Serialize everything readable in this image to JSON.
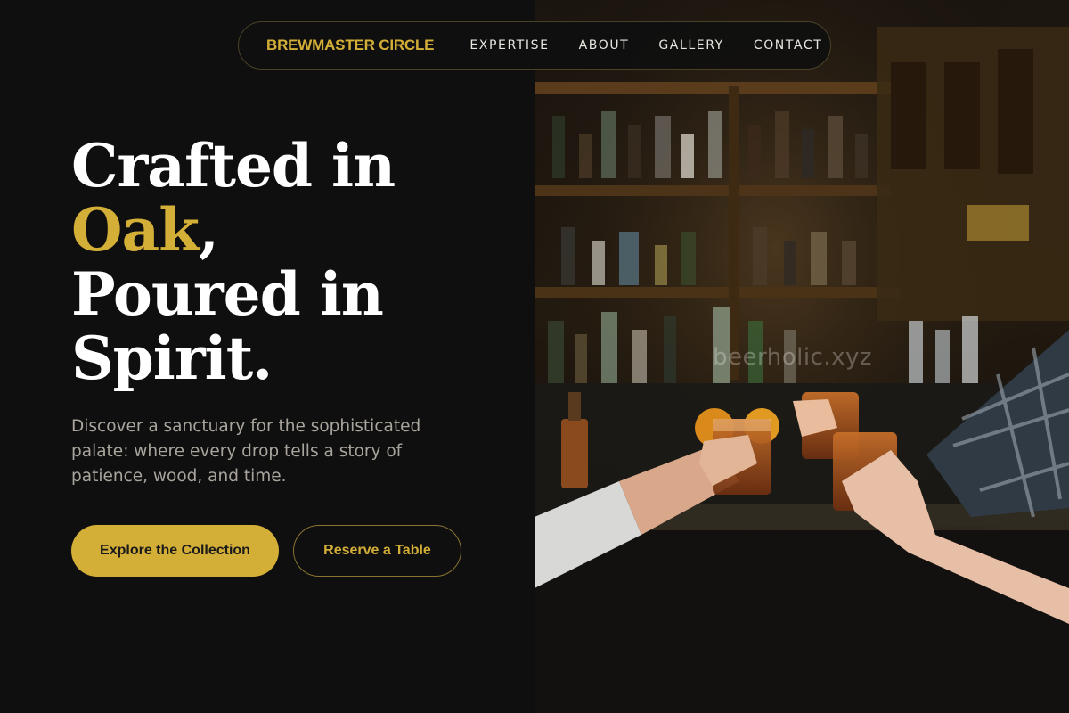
{
  "nav": {
    "brand": "BREWMASTER CIRCLE",
    "links": [
      "EXPERTISE",
      "ABOUT",
      "GALLERY",
      "CONTACT"
    ]
  },
  "hero": {
    "title_line1": "Crafted in",
    "title_accent": "Oak",
    "title_comma": ",",
    "title_line3": "Poured in",
    "title_line4": "Spirit.",
    "description": "Discover a sanctuary for the sophisticated palate: where every drop tells a story of patience, wood, and time.",
    "primary_button": "Explore the Collection",
    "secondary_button": "Reserve a Table"
  },
  "photo": {
    "watermark": "beerholic.xyz",
    "subject": "bar-toast-photo"
  },
  "colors": {
    "accent": "#d4af37",
    "background": "#0f0f0f",
    "text": "#ffffff",
    "muted": "#a9a59d"
  }
}
